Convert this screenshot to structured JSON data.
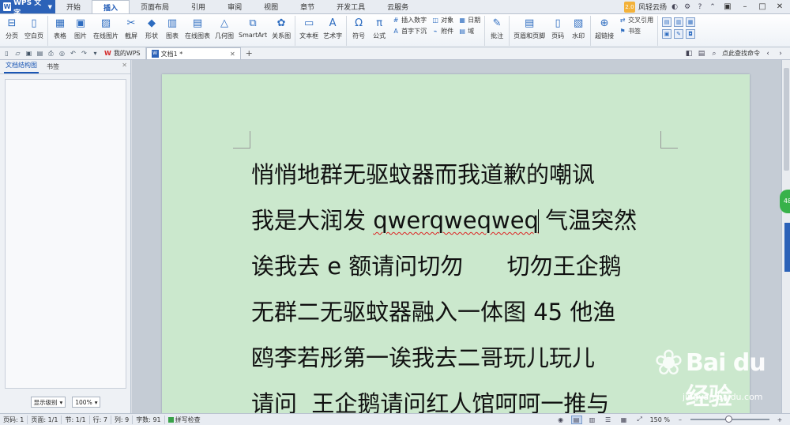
{
  "app": {
    "name": "WPS 文字",
    "logo": "W"
  },
  "menu_tabs": [
    "开始",
    "插入",
    "页面布局",
    "引用",
    "审阅",
    "视图",
    "章节",
    "开发工具",
    "云服务"
  ],
  "active_menu_tab": "插入",
  "user": {
    "name": "风轻云扬",
    "avatar_text": "2.0"
  },
  "ribbon": {
    "page": [
      "分页",
      "空白页"
    ],
    "table_image": [
      "表格",
      "图片",
      "在线图片",
      "截屏",
      "形状",
      "图表",
      "在线图表",
      "几何图",
      "SmartArt",
      "关系图"
    ],
    "text": [
      "文本框",
      "艺术字"
    ],
    "symbols": [
      "符号",
      "公式"
    ],
    "insert_small_a": [
      "插入数字",
      "首字下沉"
    ],
    "insert_small_b": [
      "对象",
      "附件"
    ],
    "insert_small_c": [
      "日期",
      "域"
    ],
    "review": [
      "批注"
    ],
    "header_footer": [
      "页眉和页脚",
      "页码",
      "水印"
    ],
    "links": [
      "超链接"
    ],
    "links_small": [
      "交叉引用",
      "书签"
    ]
  },
  "doc_tabs": [
    {
      "label": "我的WPS"
    },
    {
      "label": "文档1 *"
    }
  ],
  "search_help": "点此查找命令",
  "left_pane": {
    "tabs": [
      "文档结构图",
      "书签"
    ],
    "level_select": "显示级别",
    "zoom_select": "100%"
  },
  "document": {
    "lines": [
      "悄悄地群无驱蚊器而我道歉的嘲讽",
      "我是大润发 ",
      "诶我去 e 额请问切勿      切勿王企鹅",
      "无群二无驱蚊器融入一体图 45 他渔",
      "鸥李若彤第一诶我去二哥玩儿玩儿",
      "请问  王企鹅请问红人馆呵呵一推与"
    ],
    "line2_misspelled": "qwerqweqweq",
    "line2_tail": " 气温突然"
  },
  "side_badge": "48",
  "status": {
    "page_num": "页码: 1",
    "pages": "页面: 1/1",
    "section": "节: 1/1",
    "row": "行: 7",
    "col": "列: 9",
    "words": "字数: 91",
    "spell_check": "拼写检查",
    "zoom": "150 %"
  },
  "watermark": {
    "brand": "Bai du 经验",
    "url": "jingyan.baidu.com"
  },
  "colors": {
    "accent": "#2c62b8",
    "page_bg": "#cbe8cd",
    "spell_underline": "#d22"
  }
}
